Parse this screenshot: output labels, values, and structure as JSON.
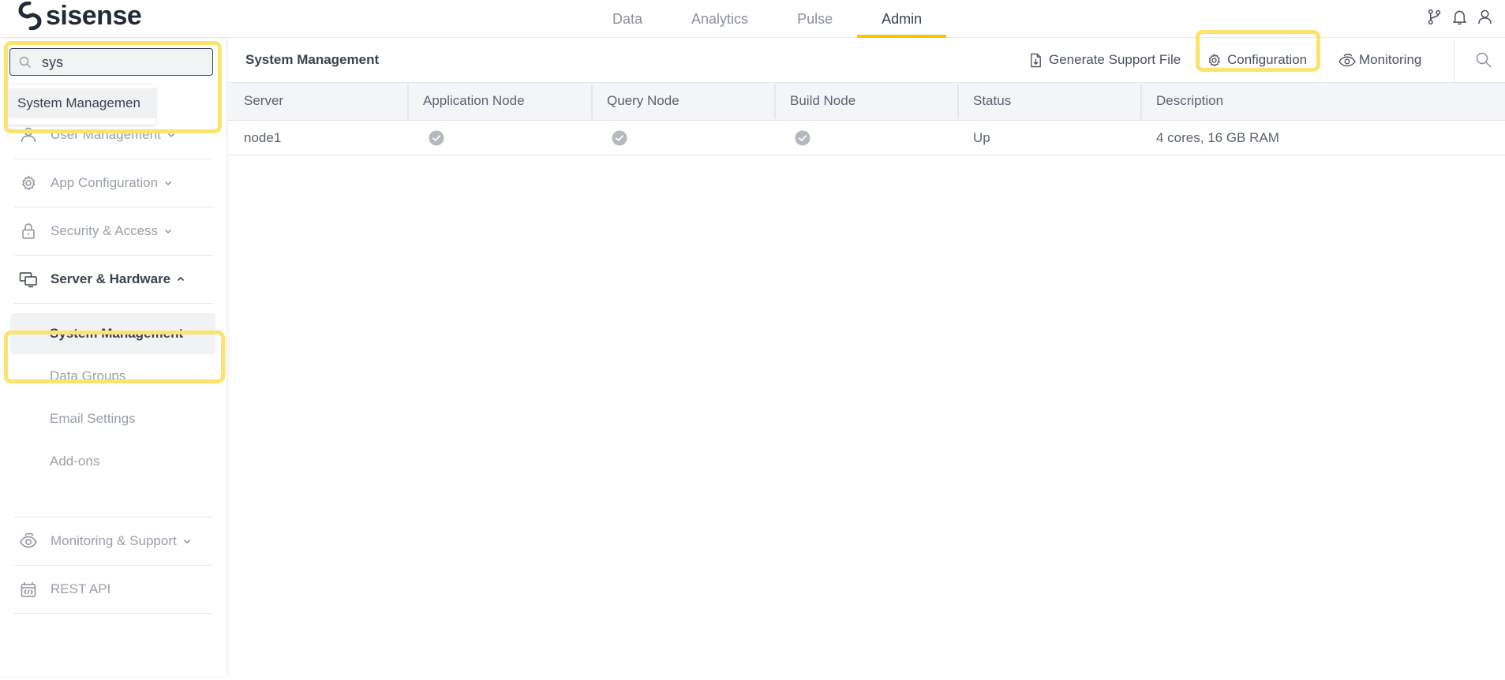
{
  "app": {
    "logo_text": "sisense",
    "nav": [
      {
        "label": "Data",
        "active": false
      },
      {
        "label": "Analytics",
        "active": false
      },
      {
        "label": "Pulse",
        "active": false
      },
      {
        "label": "Admin",
        "active": true
      }
    ],
    "top_icons": [
      "git-branch-icon",
      "bell-icon",
      "user-icon"
    ],
    "accent_color": "#f7c500",
    "highlight_color": "#fbe36d"
  },
  "sidebar": {
    "search": {
      "value": "sys",
      "placeholder": ""
    },
    "suggestion": "System Managemen",
    "menu": [
      {
        "label": "User Management",
        "icon": "user-icon",
        "expanded": false
      },
      {
        "label": "App Configuration",
        "icon": "gear-icon",
        "expanded": false
      },
      {
        "label": "Security & Access",
        "icon": "lock-icon",
        "expanded": false
      },
      {
        "label": "Server & Hardware",
        "icon": "monitors-icon",
        "expanded": true
      },
      {
        "label": "Monitoring & Support",
        "icon": "eye-cloud-icon",
        "expanded": false
      },
      {
        "label": "REST API",
        "icon": "api-icon",
        "expanded": false
      }
    ],
    "sub_items": [
      {
        "label": "System Management",
        "active": true
      },
      {
        "label": "Data Groups",
        "active": false
      },
      {
        "label": "Email Settings",
        "active": false
      },
      {
        "label": "Add-ons",
        "active": false
      }
    ]
  },
  "main": {
    "title": "System Management",
    "actions": {
      "support": "Generate Support File",
      "configuration": "Configuration",
      "monitoring": "Monitoring"
    },
    "table": {
      "columns": [
        "Server",
        "Application Node",
        "Query Node",
        "Build Node",
        "Status",
        "Description"
      ],
      "rows": [
        {
          "server": "node1",
          "application_node": true,
          "query_node": true,
          "build_node": true,
          "status": "Up",
          "description": "4 cores, 16 GB RAM"
        }
      ]
    }
  }
}
